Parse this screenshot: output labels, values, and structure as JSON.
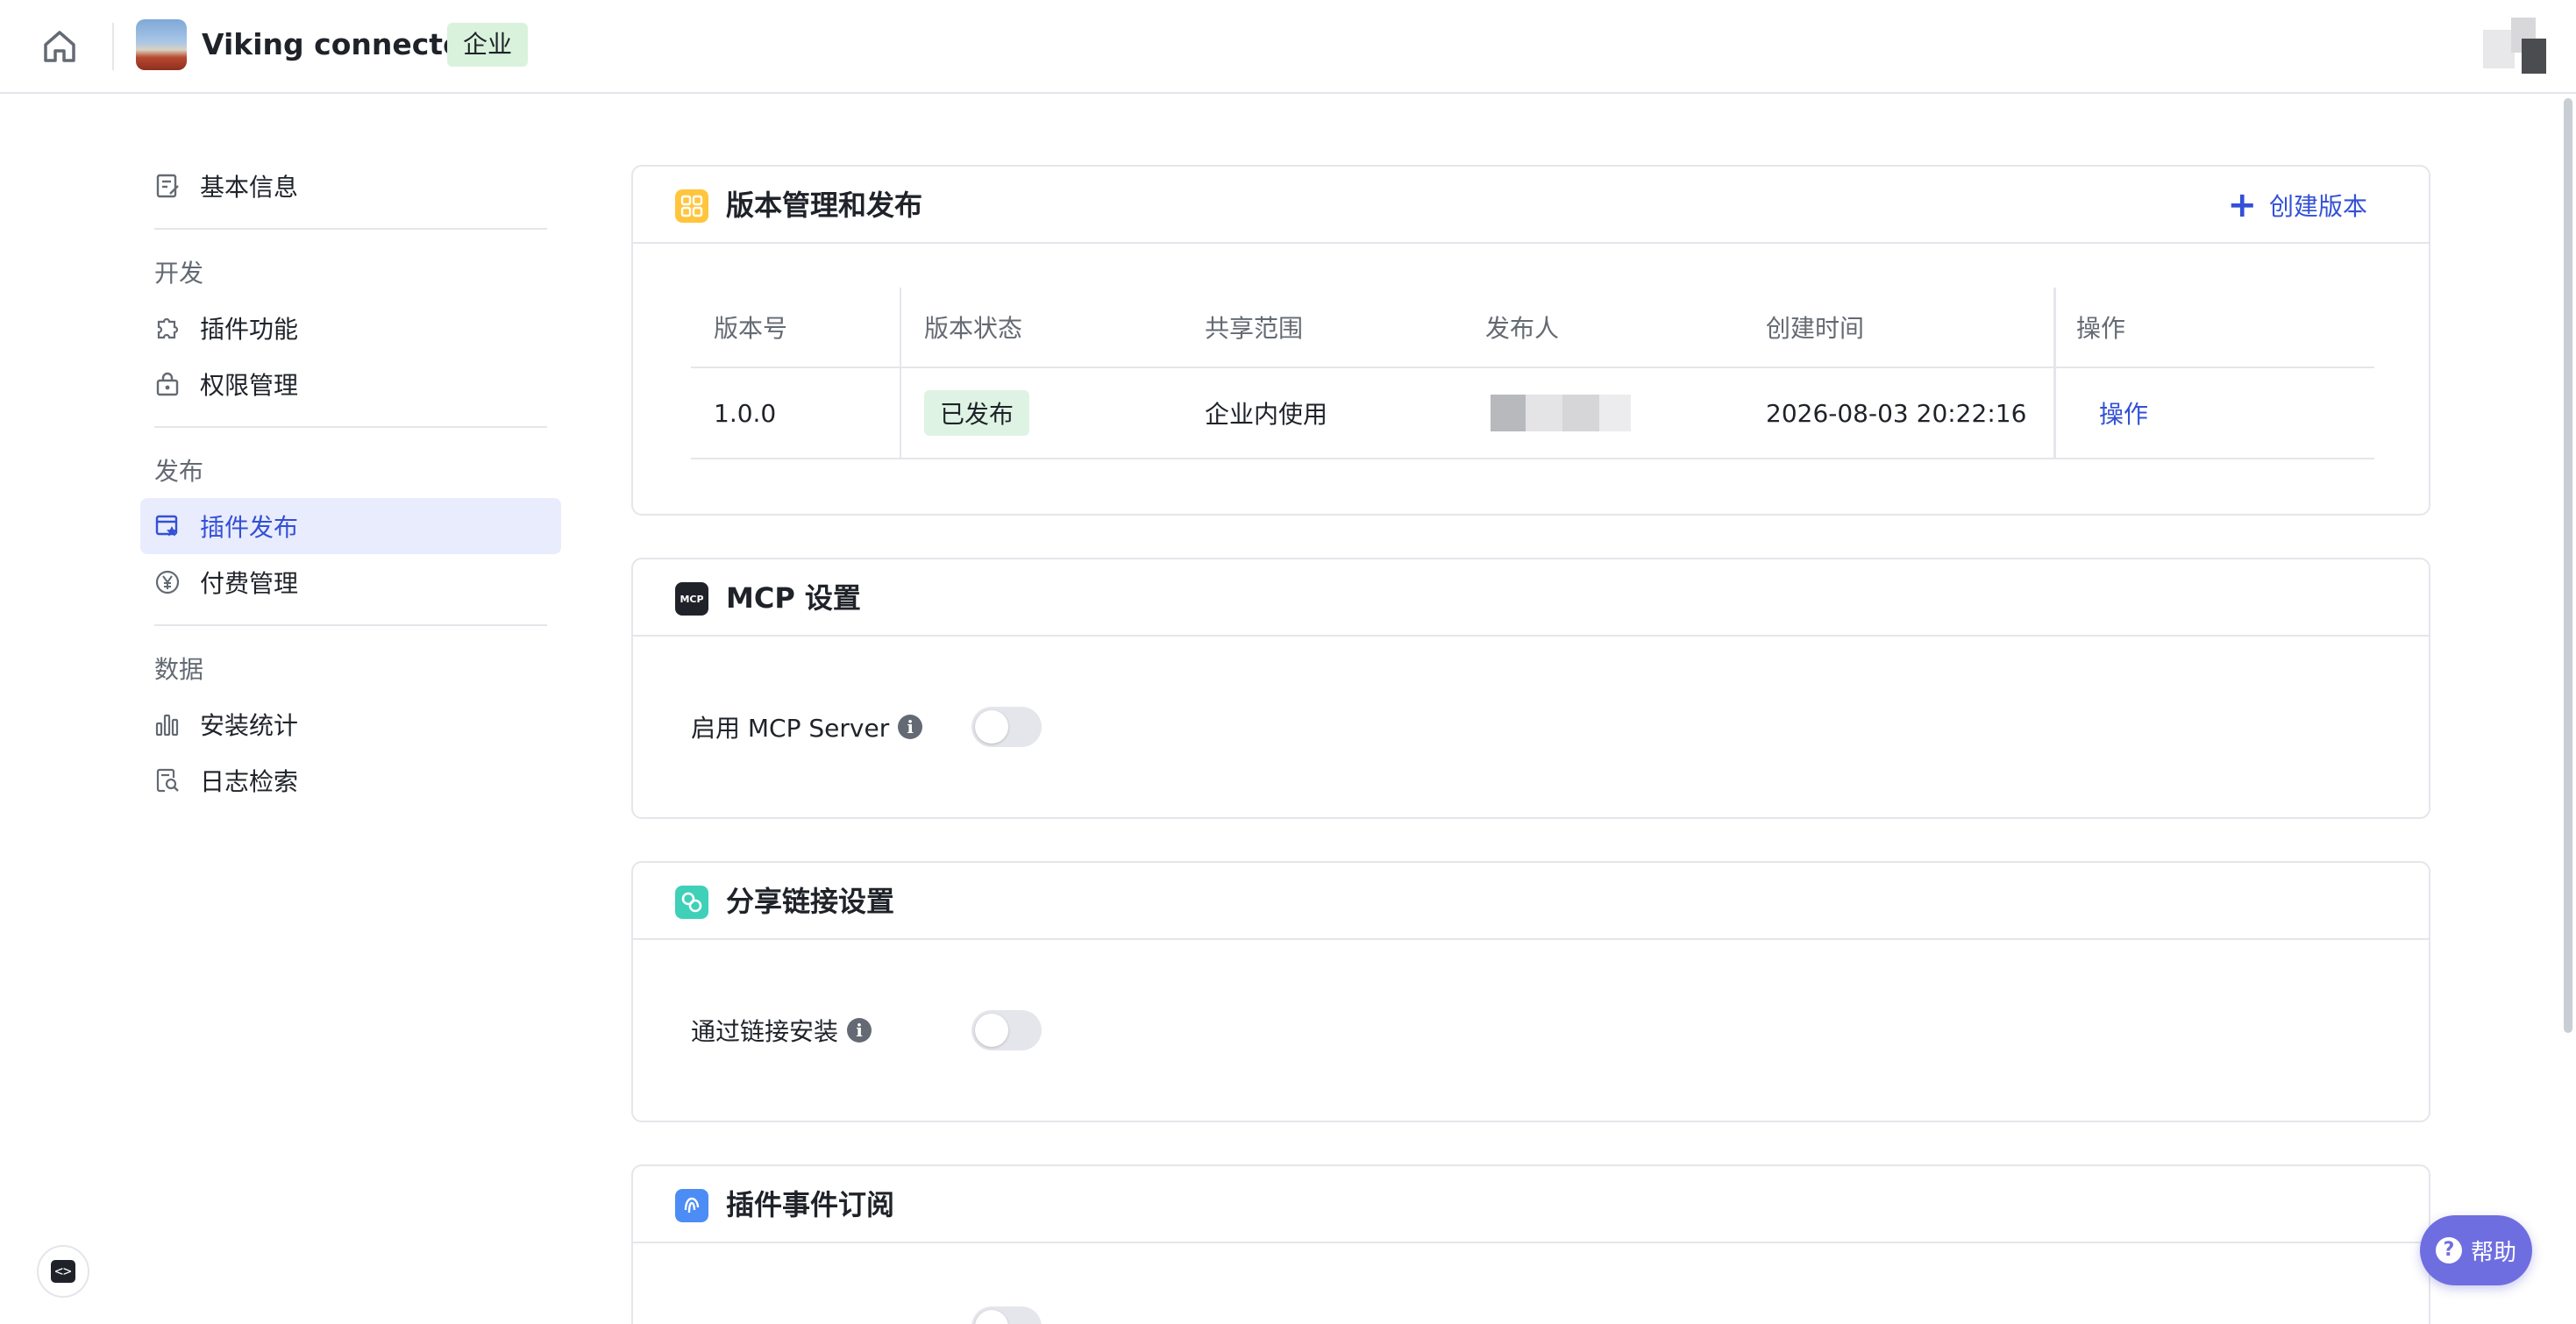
{
  "header": {
    "app_title": "Viking connector",
    "app_tag": "企业"
  },
  "sidebar": {
    "top_item": "基本信息",
    "groups": [
      {
        "label": "开发",
        "items": [
          "插件功能",
          "权限管理"
        ]
      },
      {
        "label": "发布",
        "items": [
          "插件发布",
          "付费管理"
        ]
      },
      {
        "label": "数据",
        "items": [
          "安装统计",
          "日志检索"
        ]
      }
    ],
    "active_item": "插件发布"
  },
  "version_card": {
    "title": "版本管理和发布",
    "create_label": "创建版本",
    "columns": [
      "版本号",
      "版本状态",
      "共享范围",
      "发布人",
      "创建时间",
      "操作"
    ],
    "rows": [
      {
        "version": "1.0.0",
        "status": "已发布",
        "scope": "企业内使用",
        "created": "2026-08-03 20:22:16",
        "action": "操作"
      }
    ]
  },
  "mcp_card": {
    "title": "MCP 设置",
    "icon_text": "MCP",
    "option_label": "启用 MCP Server",
    "enabled": false
  },
  "share_card": {
    "title": "分享链接设置",
    "option_label": "通过链接安装",
    "enabled": false
  },
  "event_card": {
    "title": "插件事件订阅"
  },
  "help": {
    "label": "帮助"
  },
  "colors": {
    "accent": "#3350d6",
    "active_bg": "#e8ecfd",
    "published_tag": "#dff3e4",
    "help_button": "#6f6ee0"
  }
}
